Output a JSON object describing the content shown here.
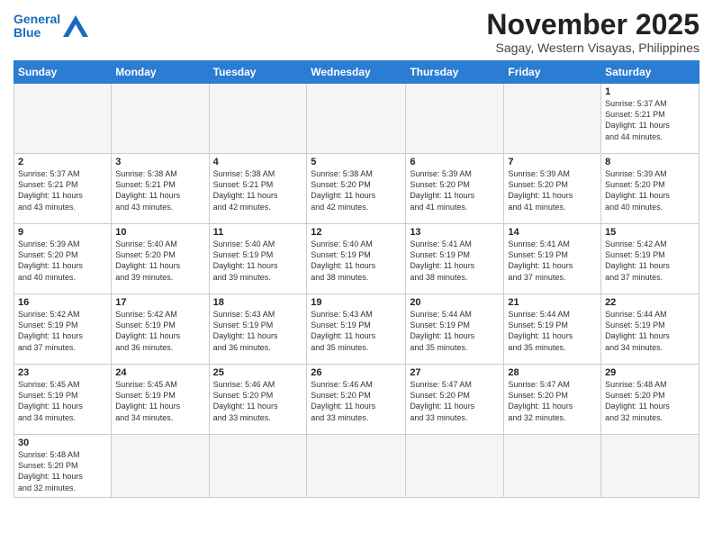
{
  "header": {
    "logo_general": "General",
    "logo_blue": "Blue",
    "month_title": "November 2025",
    "location": "Sagay, Western Visayas, Philippines"
  },
  "weekdays": [
    "Sunday",
    "Monday",
    "Tuesday",
    "Wednesday",
    "Thursday",
    "Friday",
    "Saturday"
  ],
  "weeks": [
    [
      {
        "day": "",
        "info": ""
      },
      {
        "day": "",
        "info": ""
      },
      {
        "day": "",
        "info": ""
      },
      {
        "day": "",
        "info": ""
      },
      {
        "day": "",
        "info": ""
      },
      {
        "day": "",
        "info": ""
      },
      {
        "day": "1",
        "info": "Sunrise: 5:37 AM\nSunset: 5:21 PM\nDaylight: 11 hours\nand 44 minutes."
      }
    ],
    [
      {
        "day": "2",
        "info": "Sunrise: 5:37 AM\nSunset: 5:21 PM\nDaylight: 11 hours\nand 43 minutes."
      },
      {
        "day": "3",
        "info": "Sunrise: 5:38 AM\nSunset: 5:21 PM\nDaylight: 11 hours\nand 43 minutes."
      },
      {
        "day": "4",
        "info": "Sunrise: 5:38 AM\nSunset: 5:21 PM\nDaylight: 11 hours\nand 42 minutes."
      },
      {
        "day": "5",
        "info": "Sunrise: 5:38 AM\nSunset: 5:20 PM\nDaylight: 11 hours\nand 42 minutes."
      },
      {
        "day": "6",
        "info": "Sunrise: 5:39 AM\nSunset: 5:20 PM\nDaylight: 11 hours\nand 41 minutes."
      },
      {
        "day": "7",
        "info": "Sunrise: 5:39 AM\nSunset: 5:20 PM\nDaylight: 11 hours\nand 41 minutes."
      },
      {
        "day": "8",
        "info": "Sunrise: 5:39 AM\nSunset: 5:20 PM\nDaylight: 11 hours\nand 40 minutes."
      }
    ],
    [
      {
        "day": "9",
        "info": "Sunrise: 5:39 AM\nSunset: 5:20 PM\nDaylight: 11 hours\nand 40 minutes."
      },
      {
        "day": "10",
        "info": "Sunrise: 5:40 AM\nSunset: 5:20 PM\nDaylight: 11 hours\nand 39 minutes."
      },
      {
        "day": "11",
        "info": "Sunrise: 5:40 AM\nSunset: 5:19 PM\nDaylight: 11 hours\nand 39 minutes."
      },
      {
        "day": "12",
        "info": "Sunrise: 5:40 AM\nSunset: 5:19 PM\nDaylight: 11 hours\nand 38 minutes."
      },
      {
        "day": "13",
        "info": "Sunrise: 5:41 AM\nSunset: 5:19 PM\nDaylight: 11 hours\nand 38 minutes."
      },
      {
        "day": "14",
        "info": "Sunrise: 5:41 AM\nSunset: 5:19 PM\nDaylight: 11 hours\nand 37 minutes."
      },
      {
        "day": "15",
        "info": "Sunrise: 5:42 AM\nSunset: 5:19 PM\nDaylight: 11 hours\nand 37 minutes."
      }
    ],
    [
      {
        "day": "16",
        "info": "Sunrise: 5:42 AM\nSunset: 5:19 PM\nDaylight: 11 hours\nand 37 minutes."
      },
      {
        "day": "17",
        "info": "Sunrise: 5:42 AM\nSunset: 5:19 PM\nDaylight: 11 hours\nand 36 minutes."
      },
      {
        "day": "18",
        "info": "Sunrise: 5:43 AM\nSunset: 5:19 PM\nDaylight: 11 hours\nand 36 minutes."
      },
      {
        "day": "19",
        "info": "Sunrise: 5:43 AM\nSunset: 5:19 PM\nDaylight: 11 hours\nand 35 minutes."
      },
      {
        "day": "20",
        "info": "Sunrise: 5:44 AM\nSunset: 5:19 PM\nDaylight: 11 hours\nand 35 minutes."
      },
      {
        "day": "21",
        "info": "Sunrise: 5:44 AM\nSunset: 5:19 PM\nDaylight: 11 hours\nand 35 minutes."
      },
      {
        "day": "22",
        "info": "Sunrise: 5:44 AM\nSunset: 5:19 PM\nDaylight: 11 hours\nand 34 minutes."
      }
    ],
    [
      {
        "day": "23",
        "info": "Sunrise: 5:45 AM\nSunset: 5:19 PM\nDaylight: 11 hours\nand 34 minutes."
      },
      {
        "day": "24",
        "info": "Sunrise: 5:45 AM\nSunset: 5:19 PM\nDaylight: 11 hours\nand 34 minutes."
      },
      {
        "day": "25",
        "info": "Sunrise: 5:46 AM\nSunset: 5:20 PM\nDaylight: 11 hours\nand 33 minutes."
      },
      {
        "day": "26",
        "info": "Sunrise: 5:46 AM\nSunset: 5:20 PM\nDaylight: 11 hours\nand 33 minutes."
      },
      {
        "day": "27",
        "info": "Sunrise: 5:47 AM\nSunset: 5:20 PM\nDaylight: 11 hours\nand 33 minutes."
      },
      {
        "day": "28",
        "info": "Sunrise: 5:47 AM\nSunset: 5:20 PM\nDaylight: 11 hours\nand 32 minutes."
      },
      {
        "day": "29",
        "info": "Sunrise: 5:48 AM\nSunset: 5:20 PM\nDaylight: 11 hours\nand 32 minutes."
      }
    ],
    [
      {
        "day": "30",
        "info": "Sunrise: 5:48 AM\nSunset: 5:20 PM\nDaylight: 11 hours\nand 32 minutes."
      },
      {
        "day": "",
        "info": ""
      },
      {
        "day": "",
        "info": ""
      },
      {
        "day": "",
        "info": ""
      },
      {
        "day": "",
        "info": ""
      },
      {
        "day": "",
        "info": ""
      },
      {
        "day": "",
        "info": ""
      }
    ]
  ]
}
